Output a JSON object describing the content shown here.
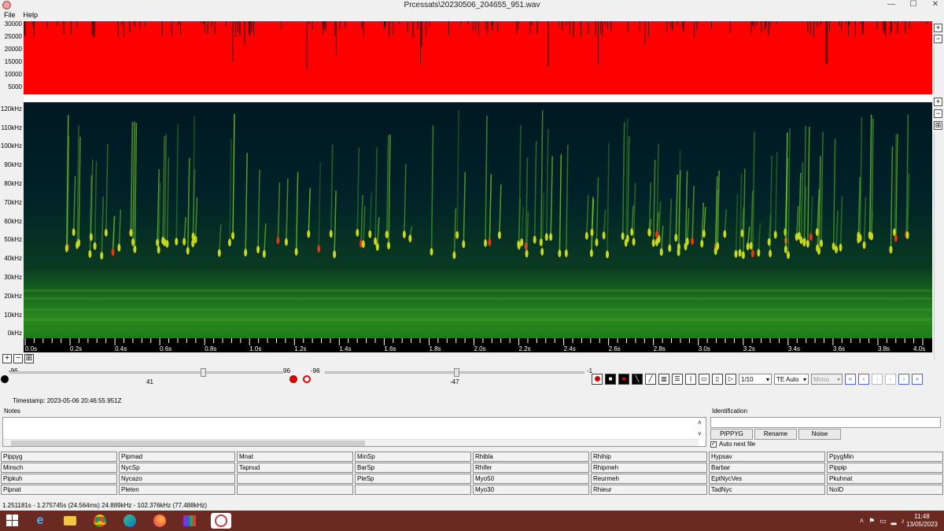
{
  "window": {
    "title": "Prcessats\\20230506_204655_951.wav",
    "minimize": "—",
    "maximize": "☐",
    "close": "✕"
  },
  "menu": [
    "File",
    "Help"
  ],
  "amplitude_axis": [
    "30000",
    "25000",
    "20000",
    "15000",
    "10000",
    "5000"
  ],
  "frequency_axis": [
    "120kHz",
    "110kHz",
    "100kHz",
    "90kHz",
    "80kHz",
    "70kHz",
    "60kHz",
    "50kHz",
    "40kHz",
    "30kHz",
    "20kHz",
    "10kHz",
    "0kHz"
  ],
  "time_axis": [
    "0.0s",
    "0.2s",
    "0.4s",
    "0.6s",
    "0.8s",
    "1.0s",
    "1.2s",
    "1.4s",
    "1.6s",
    "1.8s",
    "2.0s",
    "2.2s",
    "2.4s",
    "2.6s",
    "2.8s",
    "3.0s",
    "3.2s",
    "3.4s",
    "3.6s",
    "3.8s",
    "4.0s"
  ],
  "sliders": {
    "left": {
      "min": "-96",
      "value": "41",
      "max": "96"
    },
    "right": {
      "min": "-96",
      "value": "-47",
      "max": "-1"
    }
  },
  "colors": {
    "amplitude_bg": "#ff0000",
    "taskbar": "#6a2a22",
    "accent_blue": "#4a6ad0"
  },
  "toolbar": {
    "ratio": "1/10",
    "te_mode": "TE Auto",
    "channel": "Mono"
  },
  "timestamp": "Timestamp: 2023-05-06 20:46:55.951Z",
  "notes_label": "Notes",
  "identification": {
    "label": "Identification",
    "buttons": [
      "PIPPYG",
      "Rename",
      "Noise"
    ],
    "auto_next": "Auto next file"
  },
  "species": [
    "Pippyg",
    "Pipmad",
    "Mnat",
    "MinSp",
    "Rhibla",
    "Rhihip",
    "Hypsav",
    "PpygMin",
    "Minsch",
    "NycSp",
    "Tapnud",
    "BarSp",
    "Rhifer",
    "Rhipmeh",
    "Barbar",
    "Pippip",
    "Pipkuh",
    "Nycazo",
    "",
    "PleSp",
    "Myo50",
    "Reurmeh",
    "EptNycVes",
    "Pkuhnat",
    "Pipnat",
    "Pleten",
    "",
    "",
    "Myo30",
    "Rhieur",
    "TadNyc",
    "NoID"
  ],
  "status": "1.251181s - 1.275745s (24.564ms) 24.889kHz - 102.376kHz (77.488kHz)",
  "clock": {
    "time": "11:48",
    "date": "13/05/2023"
  }
}
